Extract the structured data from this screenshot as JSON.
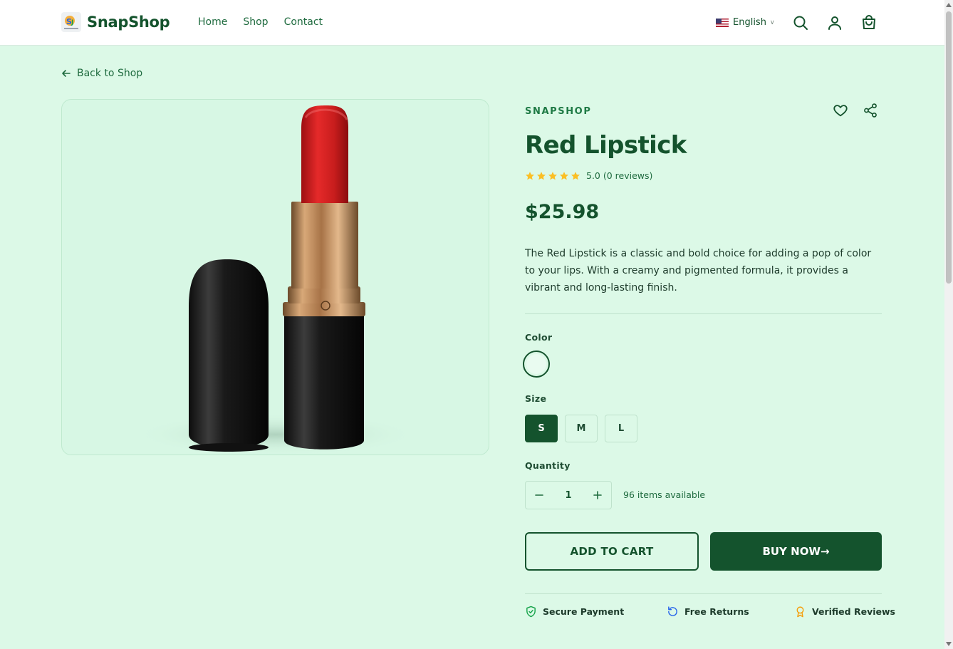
{
  "header": {
    "brand": "SnapShop",
    "nav": [
      "Home",
      "Shop",
      "Contact"
    ],
    "language": "English",
    "icons": [
      "search-icon",
      "user-icon",
      "cart-icon"
    ]
  },
  "back_link": "Back to Shop",
  "product": {
    "brand": "SNAPSHOP",
    "title": "Red Lipstick",
    "rating_text": "5.0 (0 reviews)",
    "rating": 5,
    "price": "$25.98",
    "description": "The Red Lipstick is a classic and bold choice for adding a pop of color to your lips. With a creamy and pigmented formula, it provides a vibrant and long-lasting finish.",
    "color_label": "Color",
    "size_label": "Size",
    "sizes": [
      "S",
      "M",
      "L"
    ],
    "selected_size": "S",
    "quantity_label": "Quantity",
    "quantity": "1",
    "availability": "96 items available",
    "add_to_cart": "ADD TO CART",
    "buy_now": "BUY NOW→"
  },
  "trust": {
    "secure": "Secure Payment",
    "returns": "Free Returns",
    "reviews": "Verified Reviews"
  },
  "colors": {
    "primary": "#14532d",
    "background": "#dcf9e7",
    "star": "#fbbf24"
  }
}
